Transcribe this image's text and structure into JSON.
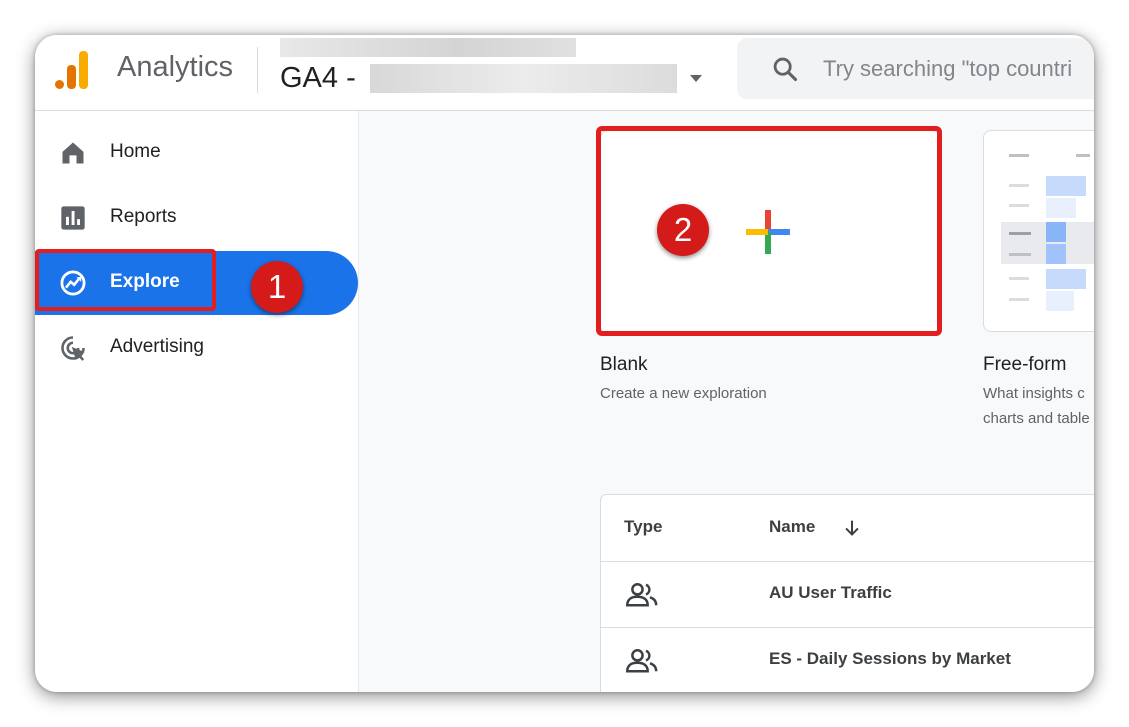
{
  "header": {
    "app_title": "Analytics",
    "property_prefix": "GA4 -",
    "search_placeholder": "Try searching \"top countri"
  },
  "sidebar": {
    "items": [
      {
        "label": "Home",
        "icon": "home-icon"
      },
      {
        "label": "Reports",
        "icon": "reports-icon"
      },
      {
        "label": "Explore",
        "icon": "explore-icon",
        "active": true
      },
      {
        "label": "Advertising",
        "icon": "advertising-icon"
      }
    ]
  },
  "annotations": {
    "step1": "1",
    "step2": "2"
  },
  "templates": [
    {
      "title": "Blank",
      "description": "Create a new exploration",
      "icon": "plus-icon"
    },
    {
      "title": "Free-form",
      "description_lines": [
        "What insights c",
        "charts and table"
      ]
    }
  ],
  "table": {
    "headers": {
      "type": "Type",
      "name": "Name"
    },
    "rows": [
      {
        "type_icon": "people-icon",
        "name": "AU User Traffic"
      },
      {
        "type_icon": "people-icon",
        "name": "ES - Daily Sessions by Market"
      }
    ]
  },
  "colors": {
    "accent": "#1a73e8",
    "annotation": "#e21e1e",
    "logo_orange": "#e37400",
    "logo_yellow": "#f9ab00"
  }
}
